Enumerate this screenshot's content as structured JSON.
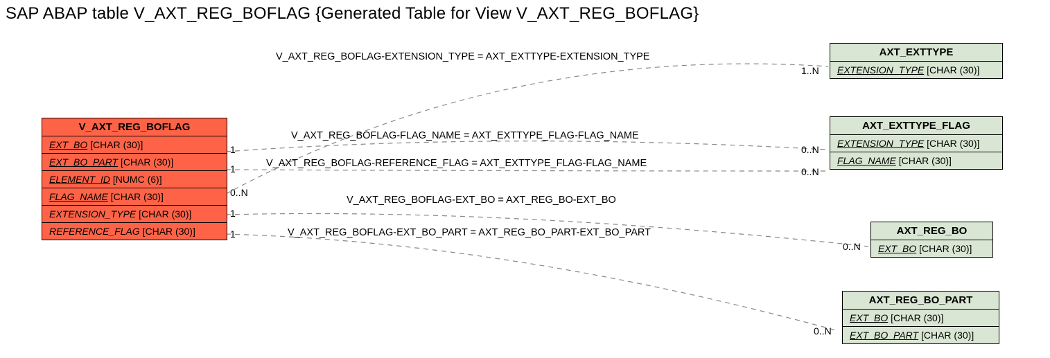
{
  "page_title": "SAP ABAP table V_AXT_REG_BOFLAG {Generated Table for View V_AXT_REG_BOFLAG}",
  "main_entity": {
    "name": "V_AXT_REG_BOFLAG",
    "fields": [
      {
        "name": "EXT_BO",
        "type": "[CHAR (30)]",
        "key": true
      },
      {
        "name": "EXT_BO_PART",
        "type": "[CHAR (30)]",
        "key": true
      },
      {
        "name": "ELEMENT_ID",
        "type": "[NUMC (6)]",
        "key": true
      },
      {
        "name": "FLAG_NAME",
        "type": "[CHAR (30)]",
        "key": true
      },
      {
        "name": "EXTENSION_TYPE",
        "type": "[CHAR (30)]",
        "key": false
      },
      {
        "name": "REFERENCE_FLAG",
        "type": "[CHAR (30)]",
        "key": false
      }
    ]
  },
  "rel_entities": [
    {
      "name": "AXT_EXTTYPE",
      "fields": [
        {
          "name": "EXTENSION_TYPE",
          "type": "[CHAR (30)]",
          "key": true
        }
      ]
    },
    {
      "name": "AXT_EXTTYPE_FLAG",
      "fields": [
        {
          "name": "EXTENSION_TYPE",
          "type": "[CHAR (30)]",
          "key": true
        },
        {
          "name": "FLAG_NAME",
          "type": "[CHAR (30)]",
          "key": true
        }
      ]
    },
    {
      "name": "AXT_REG_BO",
      "fields": [
        {
          "name": "EXT_BO",
          "type": "[CHAR (30)]",
          "key": true
        }
      ]
    },
    {
      "name": "AXT_REG_BO_PART",
      "fields": [
        {
          "name": "EXT_BO",
          "type": "[CHAR (30)]",
          "key": true
        },
        {
          "name": "EXT_BO_PART",
          "type": "[CHAR (30)]",
          "key": true
        }
      ]
    }
  ],
  "relations": [
    {
      "label": "V_AXT_REG_BOFLAG-EXTENSION_TYPE = AXT_EXTTYPE-EXTENSION_TYPE",
      "left_card": "0..N",
      "right_card": "1..N"
    },
    {
      "label": "V_AXT_REG_BOFLAG-FLAG_NAME = AXT_EXTTYPE_FLAG-FLAG_NAME",
      "left_card": "1",
      "right_card": "0..N"
    },
    {
      "label": "V_AXT_REG_BOFLAG-REFERENCE_FLAG = AXT_EXTTYPE_FLAG-FLAG_NAME",
      "left_card": "1",
      "right_card": "0..N"
    },
    {
      "label": "V_AXT_REG_BOFLAG-EXT_BO = AXT_REG_BO-EXT_BO",
      "left_card": "1",
      "right_card": "0..N"
    },
    {
      "label": "V_AXT_REG_BOFLAG-EXT_BO_PART = AXT_REG_BO_PART-EXT_BO_PART",
      "left_card": "1",
      "right_card": "0..N"
    }
  ]
}
